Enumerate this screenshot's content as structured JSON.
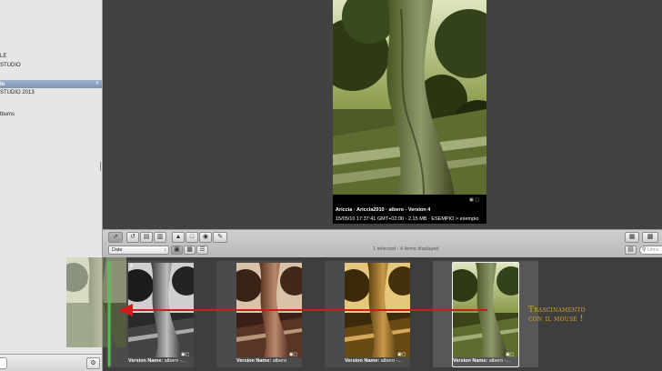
{
  "sidebar": {
    "items": [
      {
        "label": "LE"
      },
      {
        "label": "STUDIO"
      },
      {
        "label": "lo",
        "count": "4"
      },
      {
        "label": "STUDIO 2013"
      },
      {
        "label": "lbums"
      }
    ]
  },
  "viewer": {
    "meta_line1": "Ariccia · Ariccia2010 · albero - Version 4",
    "meta_line2": "15/05/10 17:37:41 GMT+02:00 · 2,15 MB · ESEMPIO > esempio"
  },
  "toolbar": {
    "sort_value": "Date",
    "status": "1 selected - 4 items displayed",
    "search_placeholder": "Unra"
  },
  "browser": {
    "items": [
      {
        "label_name": "Version Name:",
        "label_value": "albero -...",
        "badge": "4",
        "tone": "bw"
      },
      {
        "label_name": "Version Name:",
        "label_value": "albero",
        "badge": "",
        "tone": "red"
      },
      {
        "label_name": "Version Name:",
        "label_value": "albero -...",
        "badge": "",
        "tone": "sepia"
      },
      {
        "label_name": "Version Name:",
        "label_value": "albero -...",
        "badge": "",
        "tone": "color"
      }
    ]
  },
  "annotation": {
    "line1": "Trascinamento",
    "line2": "con il mouse !"
  },
  "colors": {
    "annotation": "#d6a72a",
    "drag_arrow": "#d11a1a",
    "drop_indicator": "#4fbf4f",
    "sidebar_selection": "#8a9cbb"
  }
}
